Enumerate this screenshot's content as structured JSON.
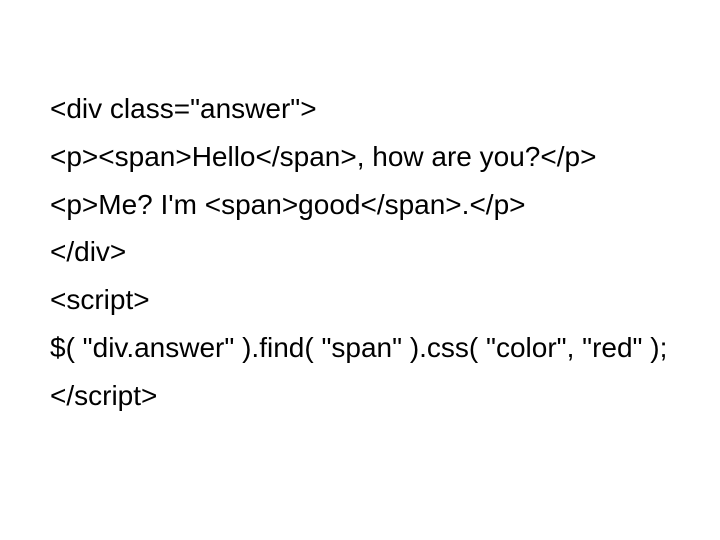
{
  "lines": {
    "l1": "<div class=\"answer\">",
    "l2": "<p><span>Hello</span>, how are you?</p>",
    "l3": "<p>Me? I'm <span>good</span>.</p>",
    "l4": "</div>",
    "l5": "<script>",
    "l6": "$( \"div.answer\" ).find( \"span\" ).css( \"color\", \"red\" );",
    "l7": "</script>"
  }
}
